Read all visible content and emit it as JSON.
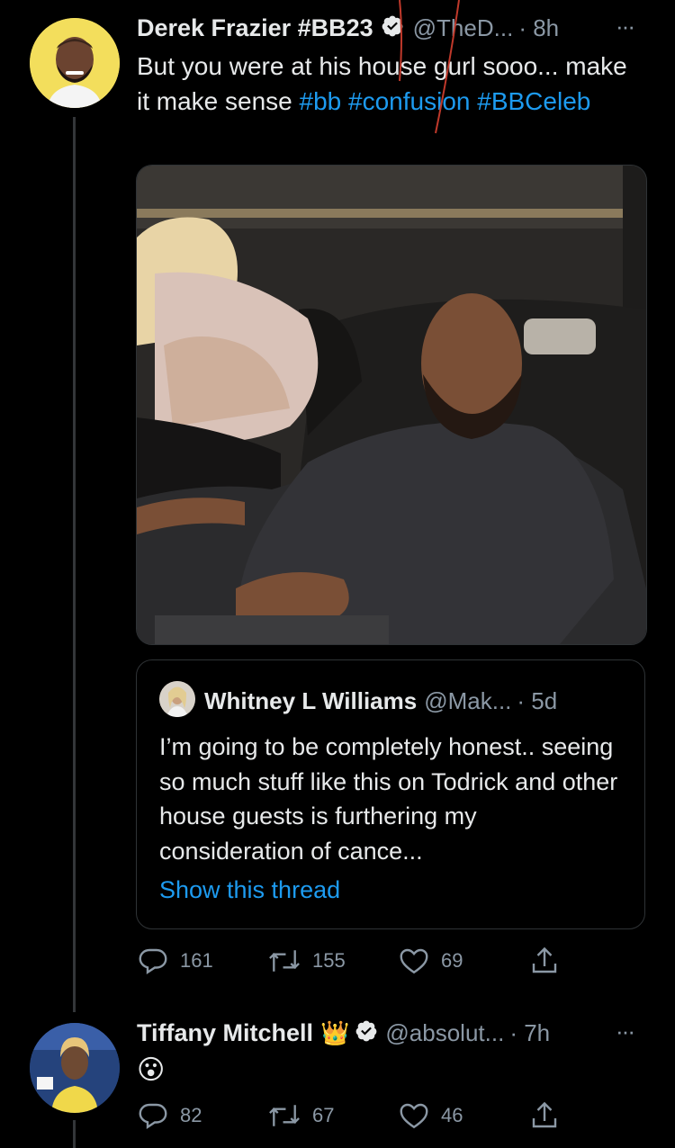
{
  "tweet1": {
    "name": "Derek Frazier #BB23",
    "handle": "@TheD...",
    "time": "· 8h",
    "text_plain": "But you were at his house gurl sooo... make it make sense ",
    "hashtag1": "#bb",
    "hashtag2": "#confusion",
    "hashtag3": "#BBCeleb",
    "more": "···",
    "quote": {
      "name": "Whitney L Williams",
      "handle": "@Mak...",
      "time": "· 5d",
      "text": "I’m going to be completely honest.. seeing so much stuff like this on Todrick and other house guests is furthering my consideration of cance...",
      "show_thread": "Show this thread"
    },
    "actions": {
      "replies": "161",
      "retweets": "155",
      "likes": "69"
    }
  },
  "tweet2": {
    "name": "Tiffany Mitchell",
    "name_emoji": "👑",
    "handle": "@absolut...",
    "time": "· 7h",
    "text": "😮",
    "more": "···",
    "actions": {
      "replies": "82",
      "retweets": "67",
      "likes": "46"
    }
  },
  "colors": {
    "accent": "#1d9bf0",
    "muted": "#8b98a5",
    "background": "#000000"
  },
  "icons": [
    "verified-badge-icon",
    "more-icon",
    "reply-icon",
    "retweet-icon",
    "like-icon",
    "share-icon"
  ]
}
